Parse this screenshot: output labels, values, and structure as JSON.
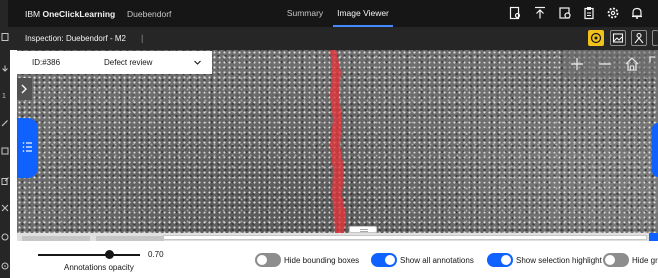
{
  "header": {
    "brand_prefix": "IBM",
    "brand_name": "OneClickLearning",
    "location": "Duebendorf",
    "tabs": [
      {
        "label": "Summary",
        "active": false
      },
      {
        "label": "Image Viewer",
        "active": true
      }
    ],
    "icons": [
      "report-icon",
      "upload-icon",
      "timer-icon",
      "clipboard-icon",
      "gear-icon",
      "notification-icon"
    ]
  },
  "inspection": {
    "label": "Inspection:",
    "value": "Duebendorf - M2",
    "separator": "|",
    "tools": [
      "light-bulb-icon",
      "image-icon",
      "annotate-icon",
      "settings-icon"
    ]
  },
  "viewer": {
    "id_label": "ID:#386",
    "mode_value": "Defect review",
    "defect_color": "#e5333a",
    "zoom_icons": [
      "zoom-in-icon",
      "zoom-out-icon",
      "home-icon",
      "fullscreen-icon"
    ]
  },
  "controls": {
    "opacity_label": "Annotations opacity",
    "opacity_value": "0.70",
    "opacity_fraction": 0.7,
    "toggles": [
      {
        "label": "Hide bounding boxes",
        "on": false
      },
      {
        "label": "Show all annotations",
        "on": true
      },
      {
        "label": "Show selection highlight",
        "on": true
      },
      {
        "label": "Hide gri",
        "on": false
      }
    ]
  },
  "colors": {
    "accent": "#0f62fe",
    "active_tool": "#f1c21b",
    "header_bg": "#161616"
  }
}
